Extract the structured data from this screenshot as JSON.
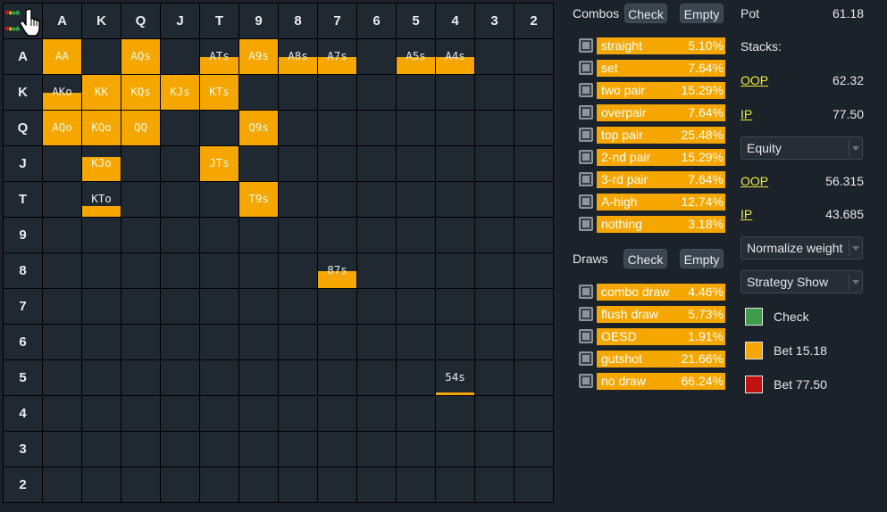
{
  "grid": {
    "col_headers": [
      "A",
      "K",
      "Q",
      "J",
      "T",
      "9",
      "8",
      "7",
      "6",
      "5",
      "4",
      "3",
      "2"
    ],
    "row_headers": [
      "A",
      "K",
      "Q",
      "J",
      "T",
      "9",
      "8",
      "7",
      "6",
      "5",
      "4",
      "3",
      "2"
    ],
    "corner_suits": {
      "top": [
        "♥",
        "♦",
        "♠",
        "♣"
      ],
      "bottom": [
        "♥",
        "♦",
        "♠",
        "♣"
      ]
    },
    "cursor_icon": "hand-pointer-icon",
    "cells": [
      {
        "row": 0,
        "col": 0,
        "label": "AA",
        "weight": 1.0
      },
      {
        "row": 0,
        "col": 2,
        "label": "AQs",
        "weight": 1.0
      },
      {
        "row": 0,
        "col": 4,
        "label": "ATs",
        "weight": 0.5
      },
      {
        "row": 0,
        "col": 5,
        "label": "A9s",
        "weight": 1.0
      },
      {
        "row": 0,
        "col": 6,
        "label": "A8s",
        "weight": 0.5
      },
      {
        "row": 0,
        "col": 7,
        "label": "A7s",
        "weight": 0.5
      },
      {
        "row": 0,
        "col": 9,
        "label": "A5s",
        "weight": 0.5
      },
      {
        "row": 0,
        "col": 10,
        "label": "A4s",
        "weight": 0.5
      },
      {
        "row": 1,
        "col": 0,
        "label": "AKo",
        "weight": 0.5
      },
      {
        "row": 1,
        "col": 1,
        "label": "KK",
        "weight": 1.0
      },
      {
        "row": 1,
        "col": 2,
        "label": "KQs",
        "weight": 1.0
      },
      {
        "row": 1,
        "col": 3,
        "label": "KJs",
        "weight": 1.0
      },
      {
        "row": 1,
        "col": 4,
        "label": "KTs",
        "weight": 1.0
      },
      {
        "row": 2,
        "col": 0,
        "label": "AQo",
        "weight": 1.0
      },
      {
        "row": 2,
        "col": 1,
        "label": "KQo",
        "weight": 1.0
      },
      {
        "row": 2,
        "col": 2,
        "label": "QQ",
        "weight": 1.0
      },
      {
        "row": 2,
        "col": 5,
        "label": "Q9s",
        "weight": 1.0
      },
      {
        "row": 3,
        "col": 1,
        "label": "KJo",
        "weight": 0.7
      },
      {
        "row": 3,
        "col": 4,
        "label": "JTs",
        "weight": 1.0
      },
      {
        "row": 4,
        "col": 1,
        "label": "KTo",
        "weight": 0.3
      },
      {
        "row": 4,
        "col": 5,
        "label": "T9s",
        "weight": 1.0
      },
      {
        "row": 6,
        "col": 7,
        "label": "87s",
        "weight": 0.5
      },
      {
        "row": 9,
        "col": 10,
        "label": "54s",
        "weight": 0.08
      }
    ]
  },
  "combos": {
    "title": "Combos",
    "check_label": "Check",
    "empty_label": "Empty",
    "items": [
      {
        "name": "straight",
        "pct": "5.10%"
      },
      {
        "name": "set",
        "pct": "7.64%"
      },
      {
        "name": "two pair",
        "pct": "15.29%"
      },
      {
        "name": "overpair",
        "pct": "7.64%"
      },
      {
        "name": "top pair",
        "pct": "25.48%"
      },
      {
        "name": "2-nd pair",
        "pct": "15.29%"
      },
      {
        "name": "3-rd pair",
        "pct": "7.64%"
      },
      {
        "name": "A-high",
        "pct": "12.74%"
      },
      {
        "name": "nothing",
        "pct": "3.18%"
      }
    ]
  },
  "draws": {
    "title": "Draws",
    "check_label": "Check",
    "empty_label": "Empty",
    "items": [
      {
        "name": "combo draw",
        "pct": "4.46%"
      },
      {
        "name": "flush draw",
        "pct": "5.73%"
      },
      {
        "name": "OESD",
        "pct": "1.91%"
      },
      {
        "name": "gutshot",
        "pct": "21.66%"
      },
      {
        "name": "no draw",
        "pct": "66.24%"
      }
    ]
  },
  "info": {
    "pot_label": "Pot",
    "pot_value": "61.18",
    "stacks_label": "Stacks:",
    "oop_label": "OOP",
    "oop_stack": "62.32",
    "ip_label": "IP",
    "ip_stack": "77.50",
    "metric_select": "Equity",
    "oop_equity": "56.315",
    "ip_equity": "43.685",
    "normalize_select": "Normalize weight",
    "strategy_select": "Strategy Show"
  },
  "legend": [
    {
      "label": "Check",
      "color": "#3e9b48"
    },
    {
      "label": "Bet 15.18",
      "color": "#f5a700"
    },
    {
      "label": "Bet 77.50",
      "color": "#c0130f"
    }
  ],
  "colors": {
    "bet_small": "#f5a700",
    "background": "#1c2229",
    "cell": "#202831"
  }
}
